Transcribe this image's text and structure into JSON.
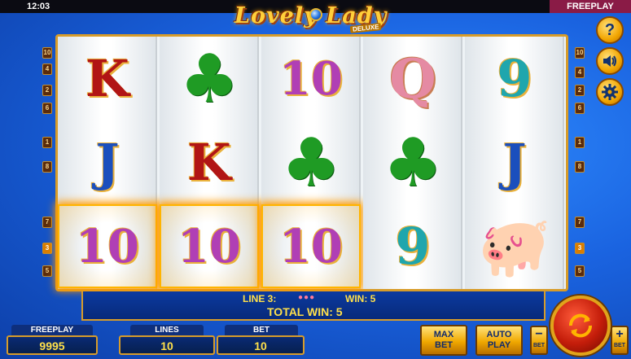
{
  "status_bar": {
    "time": "12:03",
    "mode": "FREEPLAY"
  },
  "logo": {
    "title": "Lovely Lady",
    "subtitle": "DELUXE"
  },
  "reels": [
    [
      "K",
      "J",
      "10"
    ],
    [
      "clover",
      "K",
      "10"
    ],
    [
      "10",
      "clover",
      "10"
    ],
    [
      "Q",
      "clover",
      "9"
    ],
    [
      "9",
      "J",
      "pig"
    ]
  ],
  "winning_cells": [
    [
      0,
      2
    ],
    [
      1,
      2
    ],
    [
      2,
      2
    ]
  ],
  "line_numbers": {
    "left": [
      "10",
      "4",
      "2",
      "6",
      "1",
      "8",
      "7",
      "3",
      "5"
    ],
    "right": [
      "10",
      "4",
      "2",
      "6",
      "1",
      "8",
      "7",
      "3",
      "5"
    ],
    "active": "3"
  },
  "side_buttons": {
    "help": "?",
    "sound": "speaker",
    "settings": "gear"
  },
  "win_panel": {
    "line_text": "LINE 3:",
    "line_win": "WIN: 5",
    "total_win": "TOTAL WIN: 5"
  },
  "meters": {
    "freeplay_label": "FREEPLAY",
    "freeplay_value": "9995",
    "lines_label": "LINES",
    "lines_value": "10",
    "bet_label": "BET",
    "bet_value": "10"
  },
  "buttons": {
    "max_bet_line1": "MAX",
    "max_bet_line2": "BET",
    "auto_play_line1": "AUTO",
    "auto_play_line2": "PLAY",
    "bet_minus": "−",
    "bet_plus": "+",
    "bet_sub": "BET"
  },
  "colors": {
    "background": "#1a63e0",
    "frame_gold": "#d79c2a",
    "win_text": "#ffe04a",
    "spin_red": "#c41d0a"
  }
}
